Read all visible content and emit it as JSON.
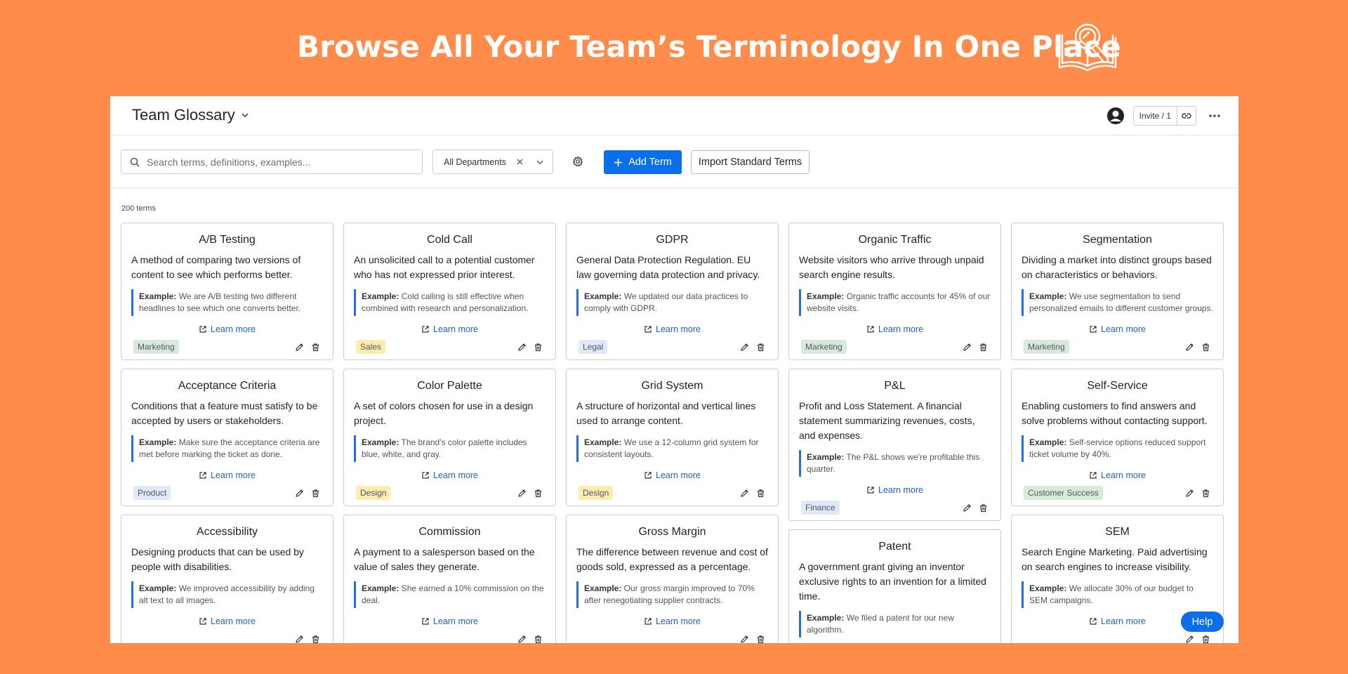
{
  "banner": {
    "title": "Browse All Your Team’s Terminology In One Place",
    "icon": "book-magnifier-icon"
  },
  "header": {
    "title": "Team Glossary",
    "invite_label": "Invite / 1"
  },
  "toolbar": {
    "search_placeholder": "Search terms, definitions, examples...",
    "department_value": "All Departments",
    "add_term_label": "Add Term",
    "import_label": "Import Standard Terms"
  },
  "term_count": "200 terms",
  "example_prefix": "Example:",
  "learn_more_label": "Learn more",
  "help_label": "Help",
  "tag_colors": {
    "Marketing": "#d8ead8",
    "Sales": "#fdecb0",
    "Legal": "#dfe9f7",
    "Product": "#dfe9f7",
    "Design": "#fdecb0",
    "Finance": "#dfe9f7",
    "Customer Success": "#d8ead8"
  },
  "columns": [
    [
      {
        "title": "A/B Testing",
        "definition": "A method of comparing two versions of content to see which performs better.",
        "example": "We are A/B testing two different headlines to see which one converts better.",
        "tag": "Marketing"
      },
      {
        "title": "Acceptance Criteria",
        "definition": "Conditions that a feature must satisfy to be accepted by users or stakeholders.",
        "example": "Make sure the acceptance criteria are met before marking the ticket as done.",
        "tag": "Product"
      },
      {
        "title": "Accessibility",
        "definition": "Designing products that can be used by people with disabilities.",
        "example": "We improved accessibility by adding alt text to all images.",
        "tag": ""
      }
    ],
    [
      {
        "title": "Cold Call",
        "definition": "An unsolicited call to a potential customer who has not expressed prior interest.",
        "example": "Cold calling is still effective when combined with research and personalization.",
        "tag": "Sales"
      },
      {
        "title": "Color Palette",
        "definition": "A set of colors chosen for use in a design project.",
        "example": "The brand's color palette includes blue, white, and gray.",
        "tag": "Design"
      },
      {
        "title": "Commission",
        "definition": "A payment to a salesperson based on the value of sales they generate.",
        "example": "She earned a 10% commission on the deal.",
        "tag": ""
      }
    ],
    [
      {
        "title": "GDPR",
        "definition": "General Data Protection Regulation. EU law governing data protection and privacy.",
        "example": "We updated our data practices to comply with GDPR.",
        "tag": "Legal"
      },
      {
        "title": "Grid System",
        "definition": "A structure of horizontal and vertical lines used to arrange content.",
        "example": "We use a 12-column grid system for consistent layouts.",
        "tag": "Design"
      },
      {
        "title": "Gross Margin",
        "definition": "The difference between revenue and cost of goods sold, expressed as a percentage.",
        "example": "Our gross margin improved to 70% after renegotiating supplier contracts.",
        "tag": ""
      }
    ],
    [
      {
        "title": "Organic Traffic",
        "definition": "Website visitors who arrive through unpaid search engine results.",
        "example": "Organic traffic accounts for 45% of our website visits.",
        "tag": "Marketing"
      },
      {
        "title": "P&L",
        "definition": "Profit and Loss Statement. A financial statement summarizing revenues, costs, and expenses.",
        "example": "The P&L shows we're profitable this quarter.",
        "tag": "Finance"
      },
      {
        "title": "Patent",
        "definition": "A government grant giving an inventor exclusive rights to an invention for a limited time.",
        "example": "We filed a patent for our new algorithm.",
        "tag": ""
      }
    ],
    [
      {
        "title": "Segmentation",
        "definition": "Dividing a market into distinct groups based on characteristics or behaviors.",
        "example": "We use segmentation to send personalized emails to different customer groups.",
        "tag": "Marketing"
      },
      {
        "title": "Self-Service",
        "definition": "Enabling customers to find answers and solve problems without contacting support.",
        "example": "Self-service options reduced support ticket volume by 40%.",
        "tag": "Customer Success"
      },
      {
        "title": "SEM",
        "definition": "Search Engine Marketing. Paid advertising on search engines to increase visibility.",
        "example": "We allocate 30% of our budget to SEM campaigns.",
        "tag": ""
      }
    ]
  ]
}
